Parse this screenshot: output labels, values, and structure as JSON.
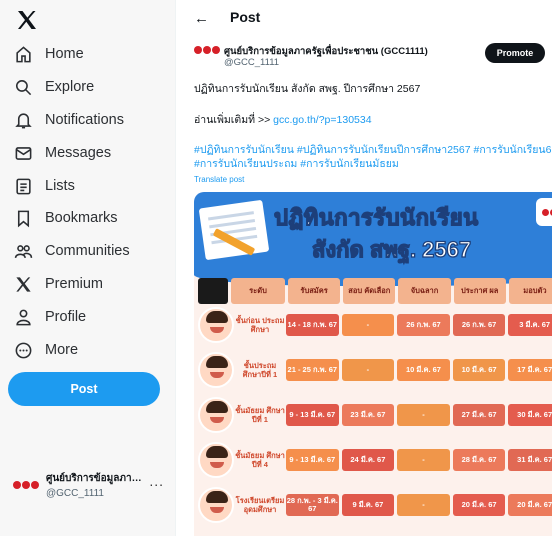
{
  "sidebar": {
    "logo": "X",
    "items": [
      {
        "label": "Home",
        "icon": "home-icon"
      },
      {
        "label": "Explore",
        "icon": "search-icon"
      },
      {
        "label": "Notifications",
        "icon": "bell-icon"
      },
      {
        "label": "Messages",
        "icon": "envelope-icon"
      },
      {
        "label": "Lists",
        "icon": "list-icon"
      },
      {
        "label": "Bookmarks",
        "icon": "bookmark-icon"
      },
      {
        "label": "Communities",
        "icon": "people-icon"
      },
      {
        "label": "Premium",
        "icon": "x-logo-icon"
      },
      {
        "label": "Profile",
        "icon": "person-icon"
      },
      {
        "label": "More",
        "icon": "more-circle-icon"
      }
    ],
    "post_button": "Post",
    "account": {
      "name": "ศูนย์บริการข้อมูลภาครั...",
      "handle": "@GCC_1111",
      "more": "..."
    }
  },
  "header": {
    "back": "←",
    "title": "Post"
  },
  "tweet": {
    "author_name": "ศูนย์บริการข้อมูลภาครัฐเพื่อประชาชน (GCC1111)",
    "author_handle": "@GCC_1111",
    "promote_label": "Promote",
    "line1": "ปฏิทินการรับนักเรียน สังกัด สพฐ. ปีการศึกษา 2567",
    "line2_prefix": "อ่านเพิ่มเติมที่ >> ",
    "line2_link": "gcc.go.th/?p=130534",
    "hashtags_line1": "#ปฏิทินการรับนักเรียน #ปฏิทินการรับนักเรียนปีการศึกษา2567 #การรับนักเรียน6",
    "hashtags_line2": "#การรับนักเรียนประถม #การรับนักเรียนมัธยม",
    "translate": "Translate post"
  },
  "poster": {
    "title1": "ปฏิทินการรับนักเรียน",
    "title2": "สังกัด สพฐ. 2567",
    "headers": [
      "ระดับ",
      "รับสมัคร",
      "สอบ คัดเลือก",
      "จับฉลาก",
      "ประกาศ ผล",
      "มอบตัว"
    ],
    "rows": [
      {
        "level": "ชั้นก่อน ประถมศึกษา",
        "cells": [
          "14 - 18 ก.พ. 67",
          "-",
          "26 ก.พ. 67",
          "26 ก.พ. 67",
          "3 มี.ค. 67"
        ]
      },
      {
        "level": "ชั้นประถม ศึกษาปีที่ 1",
        "cells": [
          "21 - 25 ก.พ. 67",
          "-",
          "10 มี.ค. 67",
          "10 มี.ค. 67",
          "17 มี.ค. 67"
        ]
      },
      {
        "level": "ชั้นมัธยม ศึกษาปีที่ 1",
        "cells": [
          "9 - 13 มี.ค. 67",
          "23 มี.ค. 67",
          "-",
          "27 มี.ค. 67",
          "30 มี.ค. 67"
        ]
      },
      {
        "level": "ชั้นมัธยม ศึกษาปีที่ 4",
        "cells": [
          "9 - 13 มี.ค. 67",
          "24 มี.ค. 67",
          "-",
          "28 มี.ค. 67",
          "31 มี.ค. 67"
        ]
      },
      {
        "level": "โรงเรียนเตรียม อุดมศึกษา",
        "cells": [
          "28 ก.พ. - 3 มี.ค. 67",
          "9 มี.ค. 67",
          "-",
          "20 มี.ค. 67",
          "20 มี.ค. 67"
        ]
      }
    ]
  }
}
